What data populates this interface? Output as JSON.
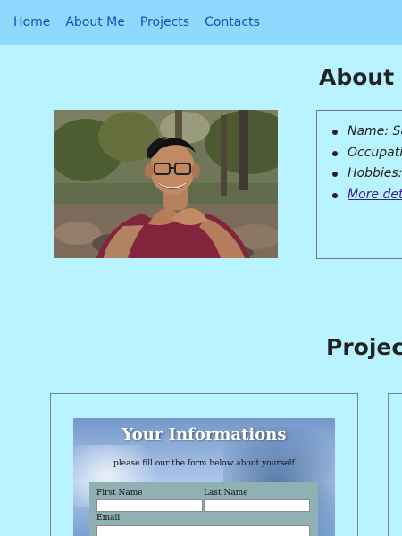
{
  "nav": {
    "items": [
      {
        "label": "Home"
      },
      {
        "label": "About Me"
      },
      {
        "label": "Projects"
      },
      {
        "label": "Contacts"
      }
    ]
  },
  "about": {
    "title": "About M",
    "details": [
      {
        "label": "Name: Sa"
      },
      {
        "label": "Occupatio"
      },
      {
        "label": "Hobbies: "
      },
      {
        "label": "More deta"
      }
    ]
  },
  "projects": {
    "title": "Project",
    "form_preview": {
      "title": "Your Informations",
      "subtitle": "please fill our the form below about yourself",
      "first_name_label": "First Name",
      "last_name_label": "Last Name",
      "email_label": "Email"
    }
  },
  "icons": {
    "profile_photo": "person-photo-icon"
  },
  "colors": {
    "page_background": "#b9f3ff",
    "nav_background": "#8fd9ff",
    "nav_link": "#1d4db6",
    "link": "#3d1b94"
  }
}
